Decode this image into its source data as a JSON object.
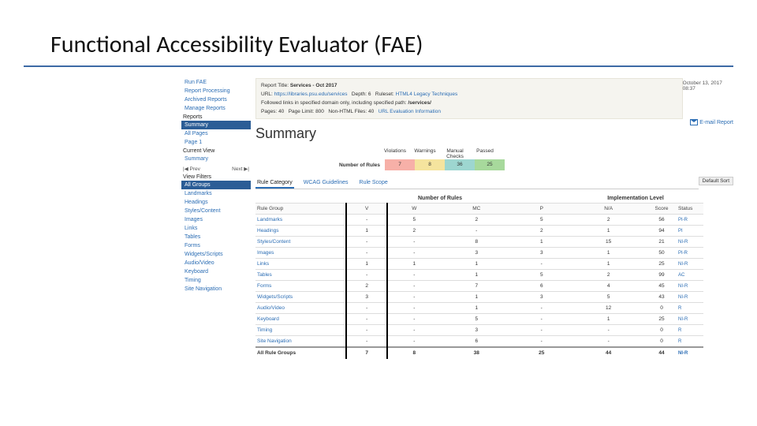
{
  "slide": {
    "title": "Functional Accessibility Evaluator (FAE)"
  },
  "sidebar": {
    "top": [
      "Run FAE",
      "Report Processing",
      "Archived Reports",
      "Manage Reports"
    ],
    "sections": {
      "reports": "Reports",
      "current": "Current View",
      "filters": "View Filters"
    },
    "reports": [
      {
        "label": "Summary",
        "selected": true
      },
      {
        "label": "All Pages",
        "selected": false
      },
      {
        "label": "Page 1",
        "selected": false
      }
    ],
    "current": [
      "Summary"
    ],
    "prev": "|◀ Prev",
    "next": "Next ▶|",
    "filters": [
      {
        "label": "All Groups",
        "selected": true
      },
      {
        "label": "Landmarks"
      },
      {
        "label": "Headings"
      },
      {
        "label": "Styles/Content"
      },
      {
        "label": "Images"
      },
      {
        "label": "Links"
      },
      {
        "label": "Tables"
      },
      {
        "label": "Forms"
      },
      {
        "label": "Widgets/Scripts"
      },
      {
        "label": "Audio/Video"
      },
      {
        "label": "Keyboard"
      },
      {
        "label": "Timing"
      },
      {
        "label": "Site Navigation"
      }
    ]
  },
  "meta": {
    "report_title_label": "Report Title:",
    "report_title": "Services - Oct 2017",
    "url_label": "URL:",
    "url": "https://libraries.psu.edu/services",
    "depth_label": "Depth:",
    "depth": "6",
    "ruleset_label": "Ruleset:",
    "ruleset": "HTML4 Legacy Techniques",
    "follow_text": "Followed links in specified domain only, including specified path:",
    "follow_path": "/services/",
    "pages_label": "Pages:",
    "pages": "40",
    "limit_label": "Page Limit:",
    "limit": "800",
    "nonhtml_label": "Non-HTML Files:",
    "nonhtml": "40",
    "eval_link": "URL Evaluation Information",
    "timestamp": "October 13, 2017 08:37"
  },
  "main": {
    "heading": "Summary",
    "email_report": "E-mail Report"
  },
  "metrics": {
    "labels": [
      "Violations",
      "Warnings",
      "Manual Checks",
      "Passed"
    ],
    "row_label": "Number of Rules",
    "values": [
      "7",
      "8",
      "36",
      "25"
    ]
  },
  "tabs": [
    "Rule Category",
    "WCAG Guidelines",
    "Rule Scope"
  ],
  "table": {
    "default_sort": "Default Sort",
    "group_headers": [
      "Number of Rules",
      "Implementation Level"
    ],
    "columns": [
      "Rule Group",
      "V",
      "W",
      "MC",
      "P",
      "N/A",
      "Score",
      "Status"
    ],
    "rows": [
      {
        "g": "Landmarks",
        "v": "-",
        "w": "5",
        "mc": "2",
        "p": "5",
        "na": "2",
        "score": "56",
        "status": "PI-R"
      },
      {
        "g": "Headings",
        "v": "1",
        "w": "2",
        "mc": "-",
        "p": "2",
        "na": "1",
        "score": "94",
        "status": "PI"
      },
      {
        "g": "Styles/Content",
        "v": "-",
        "w": "-",
        "mc": "8",
        "p": "1",
        "na": "15",
        "score": "21",
        "status": "NI-R"
      },
      {
        "g": "Images",
        "v": "-",
        "w": "-",
        "mc": "3",
        "p": "3",
        "na": "1",
        "score": "50",
        "status": "PI-R"
      },
      {
        "g": "Links",
        "v": "1",
        "w": "1",
        "mc": "1",
        "p": "-",
        "na": "1",
        "score": "25",
        "status": "NI-R"
      },
      {
        "g": "Tables",
        "v": "-",
        "w": "-",
        "mc": "1",
        "p": "5",
        "na": "2",
        "score": "99",
        "status": "AC"
      },
      {
        "g": "Forms",
        "v": "2",
        "w": "-",
        "mc": "7",
        "p": "6",
        "na": "4",
        "score": "45",
        "status": "NI-R"
      },
      {
        "g": "Widgets/Scripts",
        "v": "3",
        "w": "-",
        "mc": "1",
        "p": "3",
        "na": "5",
        "score": "43",
        "status": "NI-R"
      },
      {
        "g": "Audio/Video",
        "v": "-",
        "w": "-",
        "mc": "1",
        "p": "-",
        "na": "12",
        "score": "0",
        "status": "R"
      },
      {
        "g": "Keyboard",
        "v": "-",
        "w": "-",
        "mc": "5",
        "p": "-",
        "na": "1",
        "score": "25",
        "status": "NI-R"
      },
      {
        "g": "Timing",
        "v": "-",
        "w": "-",
        "mc": "3",
        "p": "-",
        "na": "-",
        "score": "0",
        "status": "R"
      },
      {
        "g": "Site Navigation",
        "v": "-",
        "w": "-",
        "mc": "6",
        "p": "-",
        "na": "-",
        "score": "0",
        "status": "R"
      }
    ],
    "total": {
      "g": "All Rule Groups",
      "v": "7",
      "w": "8",
      "mc": "38",
      "p": "25",
      "na": "44",
      "score": "44",
      "status": "NI-R"
    }
  }
}
